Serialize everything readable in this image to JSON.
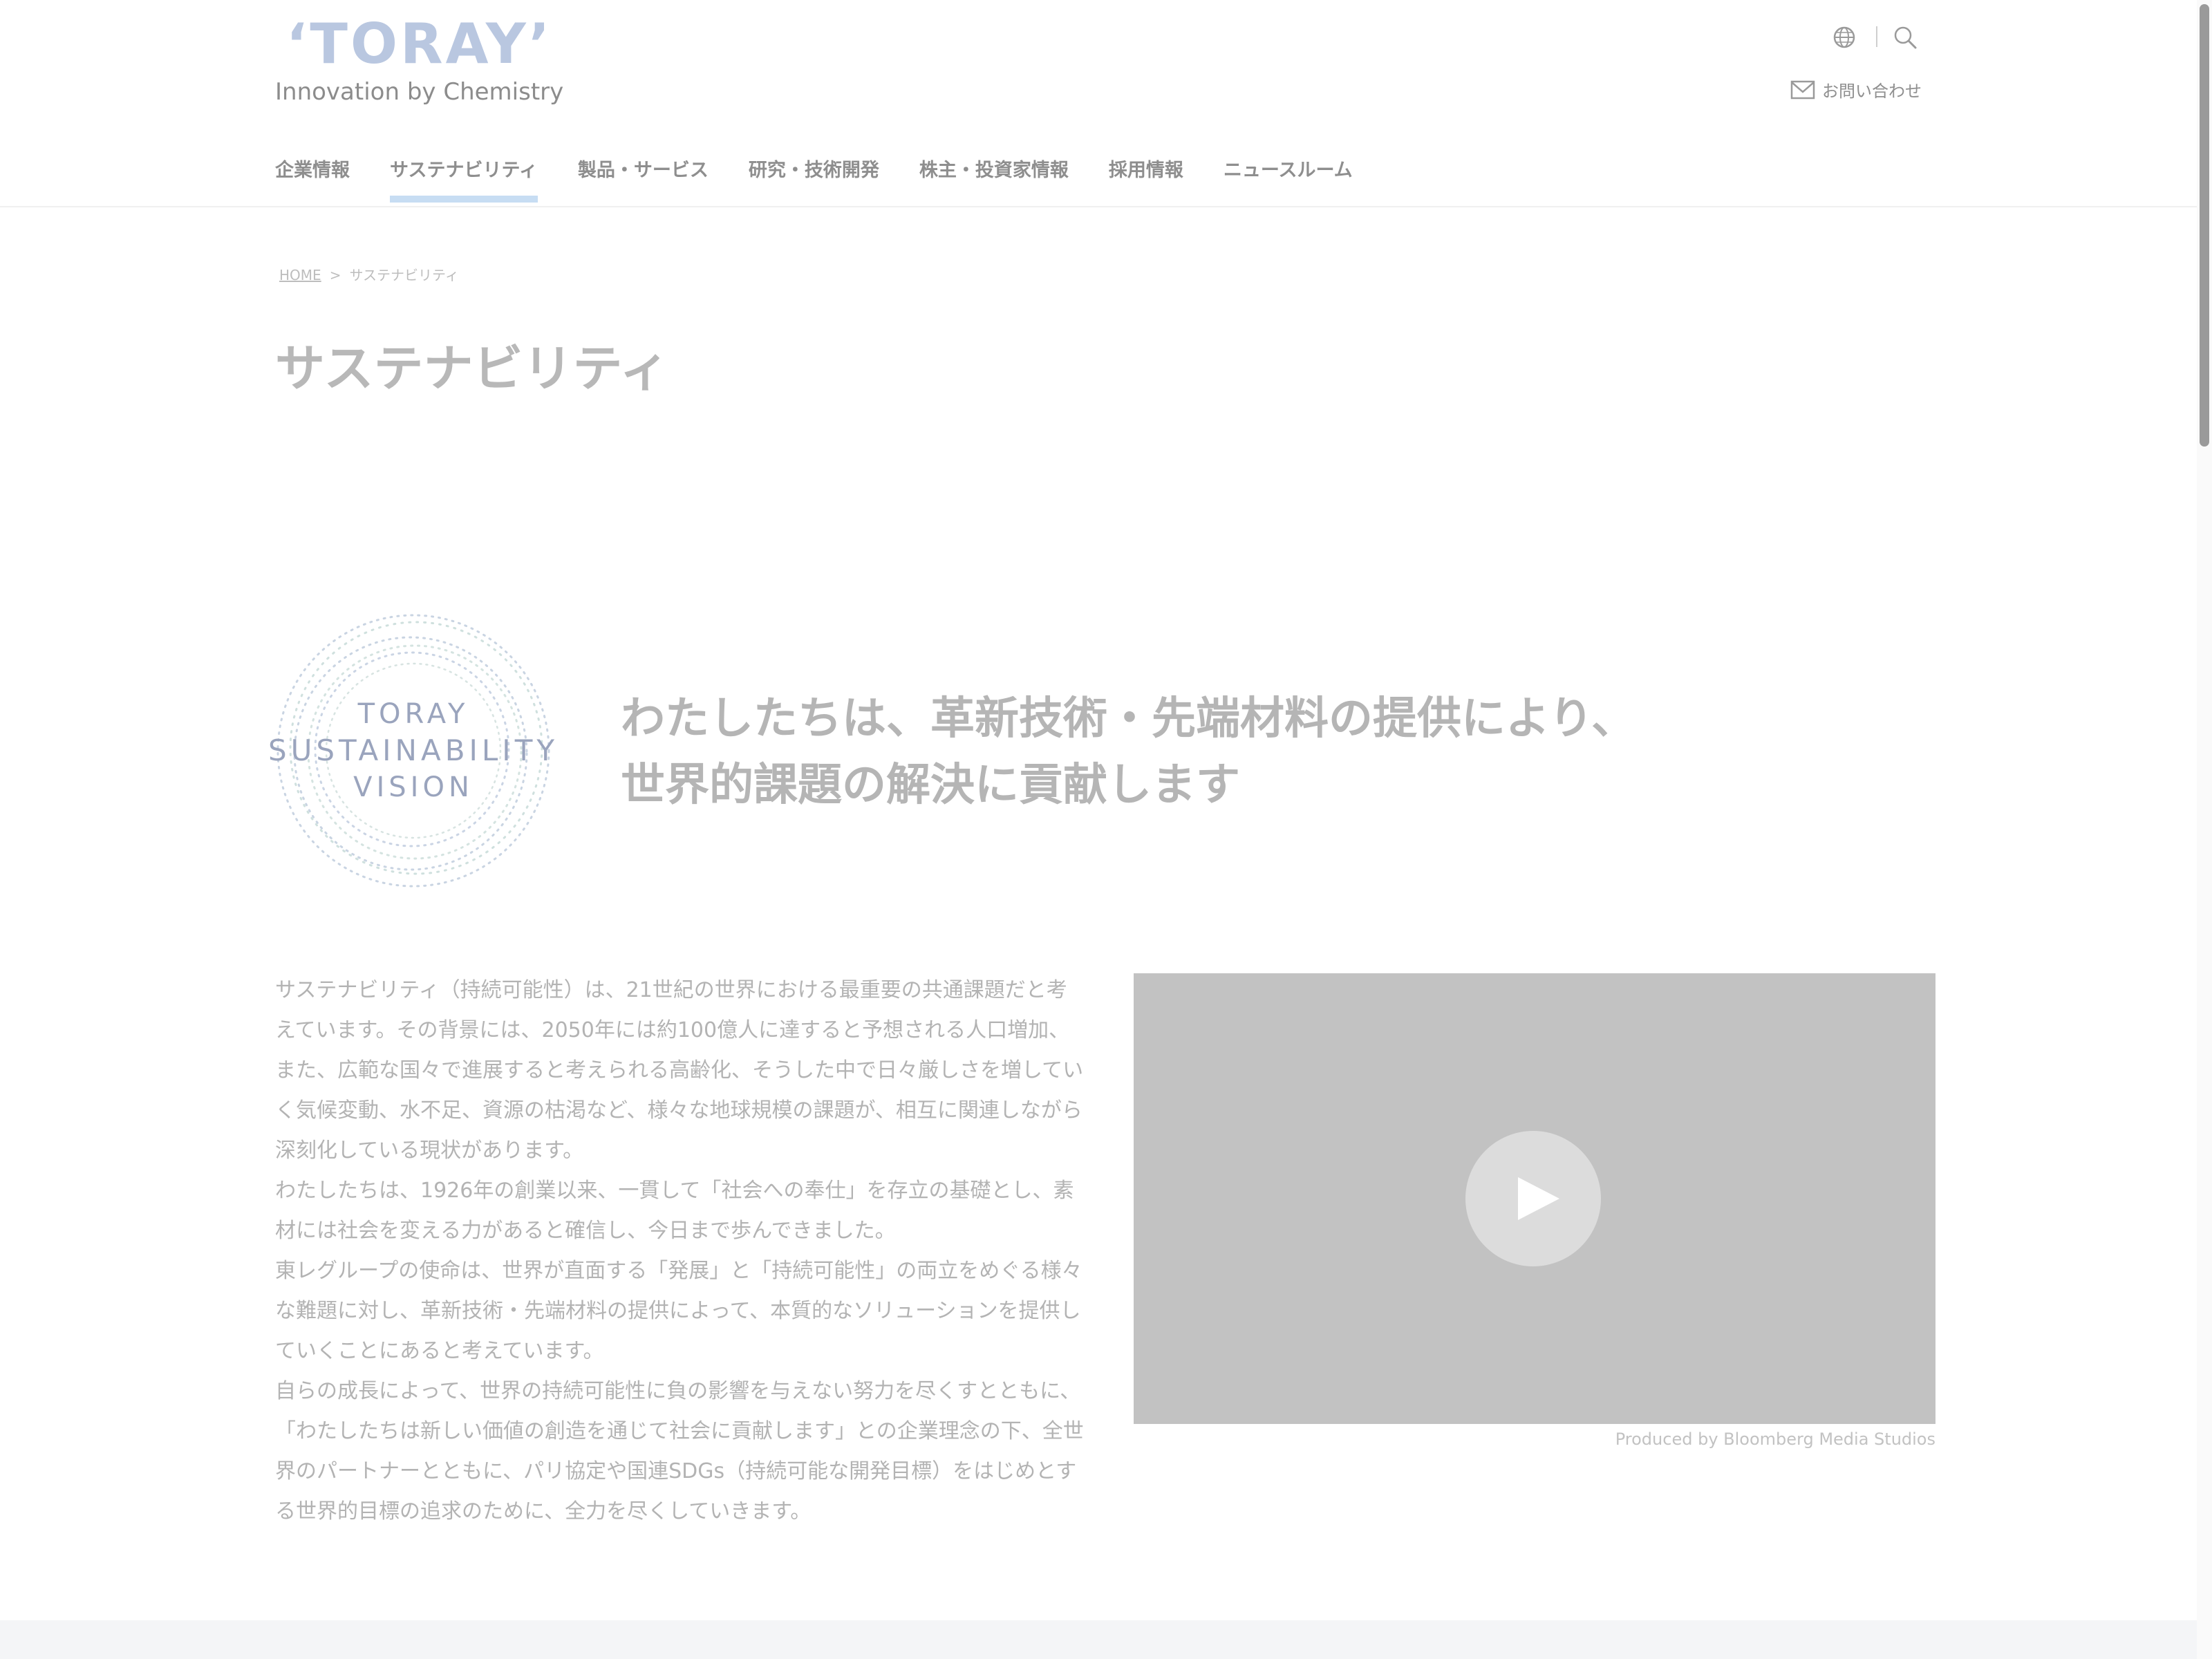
{
  "header": {
    "logo_mark": "‘TORAY’",
    "logo_tagline": "Innovation by Chemistry",
    "utility": {
      "language_icon": "globe-icon",
      "search_icon": "search-icon",
      "contact_icon": "mail-icon",
      "contact_label": "お問い合わせ"
    },
    "nav": [
      {
        "label": "企業情報"
      },
      {
        "label": "サステナビリティ",
        "active": true
      },
      {
        "label": "製品・サービス"
      },
      {
        "label": "研究・技術開発"
      },
      {
        "label": "株主・投資家情報"
      },
      {
        "label": "採用情報"
      },
      {
        "label": "ニュースルーム"
      }
    ]
  },
  "breadcrumb": {
    "home": "HOME",
    "separator": ">",
    "current": "サステナビリティ"
  },
  "page_title": "サステナビリティ",
  "vision": {
    "emblem_lines": [
      "TORAY",
      "SUSTAINABILITY",
      "VISION"
    ],
    "statement_lines": [
      "わたしたちは、革新技術・先端材料の提供により、",
      "世界的課題の解決に貢献します"
    ]
  },
  "body_paragraphs": [
    "サステナビリティ（持続可能性）は、21世紀の世界における最重要の共通課題だと考えています。その背景には、2050年には約100億人に達すると予想される人口増加、また、広範な国々で進展すると考えられる高齢化、そうした中で日々厳しさを増していく気候変動、水不足、資源の枯渇など、様々な地球規模の課題が、相互に関連しながら深刻化している現状があります。",
    "わたしたちは、1926年の創業以来、一貫して「社会への奉仕」を存立の基礎とし、素材には社会を変える力があると確信し、今日まで歩んできました。",
    "東レグループの使命は、世界が直面する「発展」と「持続可能性」の両立をめぐる様々な難題に対し、革新技術・先端材料の提供によって、本質的なソリューションを提供していくことにあると考えています。",
    "自らの成長によって、世界の持続可能性に負の影響を与えない努力を尽くすとともに、「わたしたちは新しい価値の創造を通じて社会に貢献します」との企業理念の下、全世界のパートナーとともに、パリ協定や国連SDGs（持続可能な開発目標）をはじめとする世界的目標の追求のために、全力を尽くしていきます。"
  ],
  "video": {
    "play_icon": "play-icon",
    "credit": "Produced by Bloomberg Media Studios"
  },
  "colors": {
    "logo": "#b9c7e0",
    "nav_active_underline": "#c7ddf3",
    "video_background": "#c2c2c2",
    "play_button": "#dcdcdc"
  }
}
